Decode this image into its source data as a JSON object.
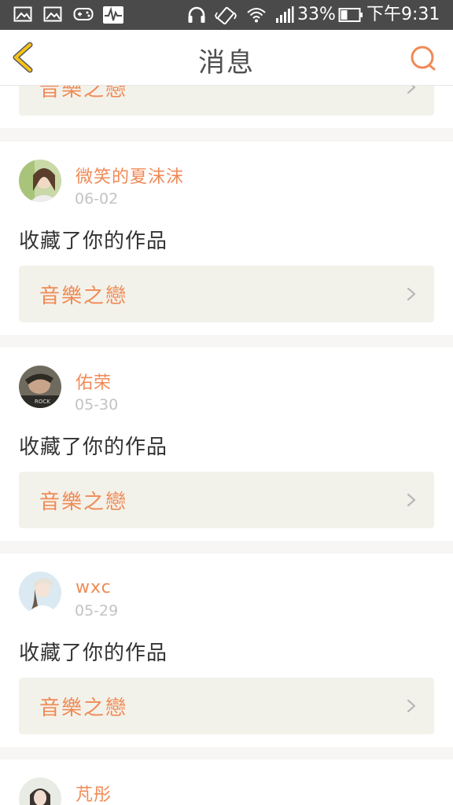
{
  "status_bar": {
    "battery": "33%",
    "time": "下午9:31",
    "icons": [
      "gallery-icon",
      "gallery-icon",
      "gamepad-icon",
      "activity-icon",
      "headphones-icon",
      "vibrate-icon",
      "wifi-icon",
      "signal-icon",
      "battery-icon"
    ]
  },
  "nav": {
    "title": "消息",
    "back_icon": "chevron-left-icon",
    "search_icon": "search-icon"
  },
  "colors": {
    "accent": "#f08a56",
    "back_arrow": "#f5c21a",
    "card_link_bg": "#f3f2ea"
  },
  "messages": [
    {
      "username": "",
      "date": "",
      "action": "",
      "work_title": "音樂之戀"
    },
    {
      "username": "微笑的夏沫沫",
      "date": "06-02",
      "action": "收藏了你的作品",
      "work_title": "音樂之戀"
    },
    {
      "username": "佑荣",
      "date": "05-30",
      "action": "收藏了你的作品",
      "work_title": "音樂之戀"
    },
    {
      "username": "wxc",
      "date": "05-29",
      "action": "收藏了你的作品",
      "work_title": "音樂之戀"
    },
    {
      "username": "芃彤",
      "date": "",
      "action": "",
      "work_title": ""
    }
  ]
}
